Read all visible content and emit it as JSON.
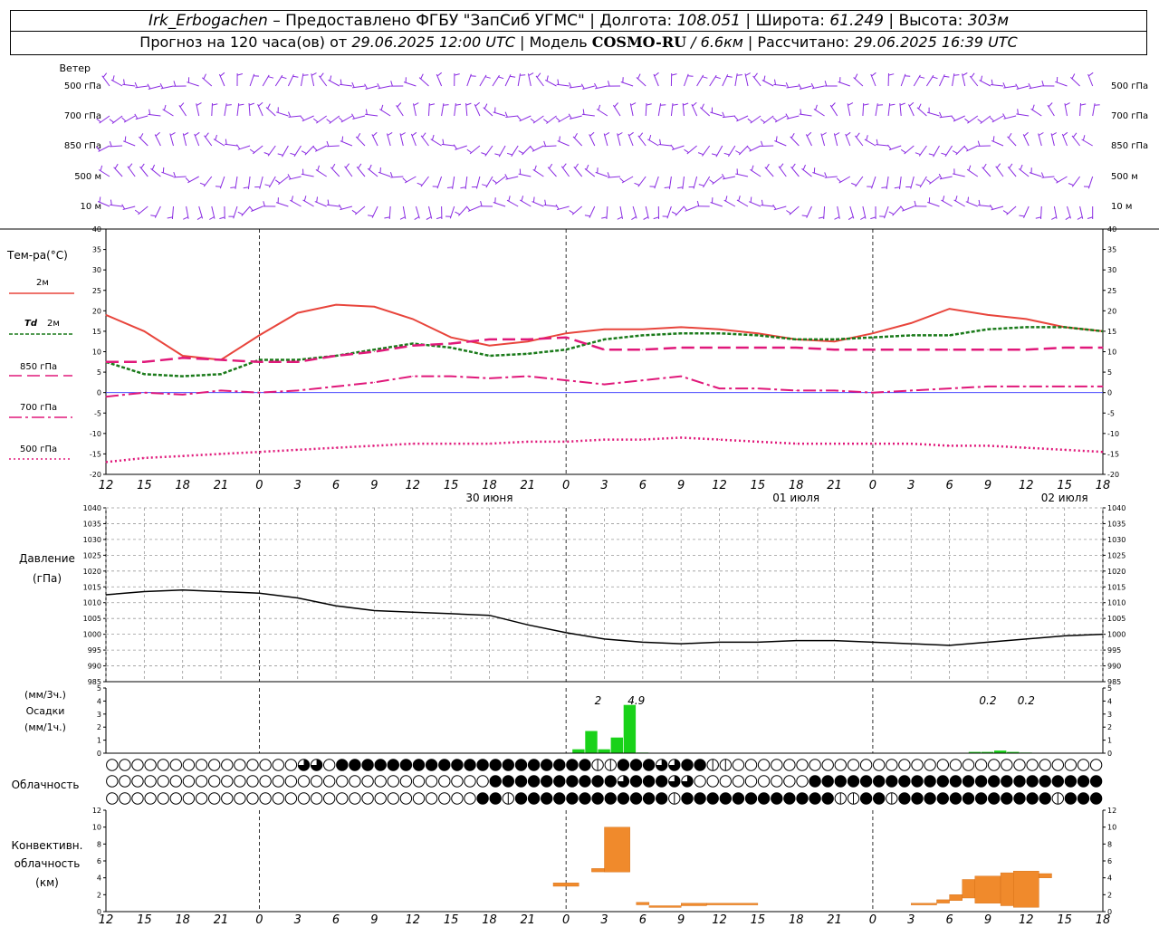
{
  "header": {
    "station": "Irk_Erbogachen",
    "provider_sep": " – ",
    "provider": "Предоставлено ФГБУ \"ЗапСиб УГМС\"",
    "lon_label": "Долгота:",
    "lon": "108.051",
    "lat_label": "Широта:",
    "lat": "61.249",
    "alt_label": "Высота:",
    "alt": "303м",
    "forecast_label": "Прогноз на 120 часа(ов) от",
    "forecast_from": "29.06.2025 12:00 UTC",
    "model_label": "Модель",
    "model": "COSMO-RU",
    "model_res": "/ 6.6км",
    "calc_label": "Рассчитано:",
    "calc": "29.06.2025 16:39 UTC"
  },
  "wind": {
    "title": "Ветер",
    "levels": [
      "500 гПа",
      "700 гПа",
      "850 гПа",
      "500 м",
      "10  м"
    ],
    "color": "#8a2be2"
  },
  "temp_legend": {
    "title": "Тем-ра(°С)",
    "t2m": "2м",
    "td_label": "Td",
    "td_level": "2м",
    "p850": "850 гПа",
    "p700": "700 гПа",
    "p500": "500 гПа"
  },
  "pressure_legend": {
    "title": "Давление",
    "unit": "(гПа)"
  },
  "precip_legend": {
    "unit3": "(мм/3ч.)",
    "title": "Осадки",
    "unit1": "(мм/1ч.)"
  },
  "cloud_legend": {
    "title": "Облачность"
  },
  "conv_legend": {
    "title": "Конвективн.",
    "title2": "облачность",
    "unit": "(км)"
  },
  "time_axis": {
    "hour_labels": [
      "12",
      "15",
      "18",
      "21",
      "0",
      "3",
      "6",
      "9",
      "12",
      "15",
      "18",
      "21",
      "0",
      "3",
      "6",
      "9",
      "12",
      "15",
      "18",
      "21",
      "0",
      "3",
      "6",
      "9",
      "12",
      "15",
      "18"
    ],
    "date_labels": [
      "30 июня",
      "01 июля",
      "02 июля"
    ],
    "midnight_indices": [
      4,
      12,
      20
    ]
  },
  "colors": {
    "t2m": "#e8453c",
    "td": "#1a7a1a",
    "p850": "#e0187a",
    "p700": "#e0187a",
    "p500": "#e0187a",
    "pressure": "#000000",
    "precip": "#19d219",
    "conv": "#f08a2c",
    "wind": "#8a2be2"
  },
  "chart_data": [
    {
      "type": "line",
      "title": "Тем-ра(°С)",
      "x_hours": [
        0,
        3,
        6,
        9,
        12,
        15,
        18,
        21,
        24,
        27,
        30,
        33,
        36,
        39,
        42,
        45,
        48,
        51,
        54,
        57,
        60,
        63,
        66,
        69,
        72,
        75,
        78
      ],
      "ylim": [
        -20,
        40
      ],
      "yticks": [
        -20,
        -15,
        -10,
        -5,
        0,
        5,
        10,
        15,
        20,
        25,
        30,
        35,
        40
      ],
      "series": [
        {
          "name": "2м",
          "key": "t2m",
          "values": [
            19,
            15,
            9,
            8,
            14,
            19.5,
            21.5,
            21,
            18,
            13.5,
            11.5,
            12.5,
            14.5,
            15.5,
            15.5,
            16,
            15.5,
            14.5,
            13,
            12.5,
            14.5,
            17,
            20.5,
            19,
            18,
            16,
            15
          ]
        },
        {
          "name": "Td 2м",
          "key": "td",
          "values": [
            7.5,
            4.5,
            4,
            4.5,
            8,
            8,
            9,
            10.5,
            12,
            11,
            9,
            9.5,
            10.5,
            13,
            14,
            14.5,
            14.5,
            14,
            13,
            13,
            13.5,
            14,
            14,
            15.5,
            16,
            16,
            15
          ]
        },
        {
          "name": "850 гПа",
          "key": "p850",
          "values": [
            7.5,
            7.5,
            8.5,
            8,
            7.5,
            7.5,
            9,
            10,
            11.5,
            12,
            13,
            13,
            13.5,
            10.5,
            10.5,
            11,
            11,
            11,
            11,
            10.5,
            10.5,
            10.5,
            10.5,
            10.5,
            10.5,
            11,
            11
          ]
        },
        {
          "name": "700 гПа",
          "key": "p700",
          "values": [
            -1,
            0,
            -0.5,
            0.5,
            0,
            0.5,
            1.5,
            2.5,
            4,
            4,
            3.5,
            4,
            3,
            2,
            3,
            4,
            1,
            1,
            0.5,
            0.5,
            0,
            0.5,
            1,
            1.5,
            1.5,
            1.5,
            1.5
          ]
        },
        {
          "name": "500 гПа",
          "key": "p500",
          "values": [
            -17,
            -16,
            -15.5,
            -15,
            -14.5,
            -14,
            -13.5,
            -13,
            -12.5,
            -12.5,
            -12.5,
            -12,
            -12,
            -11.5,
            -11.5,
            -11,
            -11.5,
            -12,
            -12.5,
            -12.5,
            -12.5,
            -12.5,
            -13,
            -13,
            -13.5,
            -14,
            -14.5
          ]
        }
      ]
    },
    {
      "type": "line",
      "title": "Давление",
      "ylabel": "(гПа)",
      "x_hours": [
        0,
        3,
        6,
        9,
        12,
        15,
        18,
        21,
        24,
        27,
        30,
        33,
        36,
        39,
        42,
        45,
        48,
        51,
        54,
        57,
        60,
        63,
        66,
        69,
        72,
        75,
        78
      ],
      "ylim": [
        985,
        1040
      ],
      "yticks": [
        985,
        990,
        995,
        1000,
        1005,
        1010,
        1015,
        1020,
        1025,
        1030,
        1035,
        1040
      ],
      "series": [
        {
          "name": "",
          "key": "pressure",
          "values": [
            1012.5,
            1013.5,
            1014,
            1013.5,
            1013,
            1011.5,
            1009,
            1007.5,
            1007,
            1006.5,
            1006,
            1003,
            1000.5,
            998.5,
            997.5,
            997,
            997.5,
            997.5,
            998,
            998,
            997.5,
            997,
            996.5,
            997.5,
            998.5,
            999.5,
            1000
          ]
        }
      ]
    },
    {
      "type": "bar",
      "title": "Осадки",
      "ylim": [
        0,
        5
      ],
      "yticks": [
        0,
        1,
        2,
        3,
        4,
        5
      ],
      "bars_hour": [
        37,
        38,
        39,
        40,
        41,
        42
      ],
      "bars_value": [
        0.3,
        1.7,
        0.3,
        1.2,
        3.7,
        0.05
      ],
      "bars2_hour": [
        68,
        69,
        70,
        71,
        72
      ],
      "bars2_value": [
        0.1,
        0.1,
        0.2,
        0.1,
        0.05
      ],
      "annotations": [
        {
          "hour": 38.5,
          "text": "2"
        },
        {
          "hour": 41.5,
          "text": "4.9"
        },
        {
          "hour": 69,
          "text": "0.2"
        },
        {
          "hour": 72,
          "text": "0.2"
        }
      ]
    },
    {
      "type": "bar",
      "title": "Конвективн. облачность",
      "ylabel": "(км)",
      "ylim": [
        0,
        12
      ],
      "yticks": [
        0,
        2,
        4,
        6,
        8,
        10,
        12
      ],
      "segments": [
        {
          "from": 35,
          "to": 37,
          "bottom": 3,
          "top": 3.4
        },
        {
          "from": 38,
          "to": 39,
          "bottom": 4.7,
          "top": 5.1
        },
        {
          "from": 39,
          "to": 41,
          "bottom": 4.7,
          "top": 10
        },
        {
          "from": 41.5,
          "to": 42.5,
          "bottom": 0.8,
          "top": 1.1
        },
        {
          "from": 42.5,
          "to": 45,
          "bottom": 0.5,
          "top": 0.7
        },
        {
          "from": 45,
          "to": 47,
          "bottom": 0.7,
          "top": 1.0
        },
        {
          "from": 47,
          "to": 51,
          "bottom": 0.8,
          "top": 1.0
        },
        {
          "from": 63,
          "to": 65,
          "bottom": 0.8,
          "top": 1.0
        },
        {
          "from": 65,
          "to": 66,
          "bottom": 1.0,
          "top": 1.4
        },
        {
          "from": 66,
          "to": 67,
          "bottom": 1.3,
          "top": 2.0
        },
        {
          "from": 67,
          "to": 68,
          "bottom": 1.6,
          "top": 3.8
        },
        {
          "from": 68,
          "to": 70,
          "bottom": 1.0,
          "top": 4.2
        },
        {
          "from": 70,
          "to": 71,
          "bottom": 0.7,
          "top": 4.6
        },
        {
          "from": 71,
          "to": 73,
          "bottom": 0.5,
          "top": 4.8
        },
        {
          "from": 73,
          "to": 74,
          "bottom": 4.0,
          "top": 4.5
        }
      ]
    }
  ],
  "cloud_rows": [
    "000000000000000330222222222222222222221122233221100000000000000000000000000000",
    "000000000000000000000000000000222222222232223300000000022222222222222222222222",
    "000000000000000000000000000002212222222222221222222222222112212222222222221222"
  ]
}
